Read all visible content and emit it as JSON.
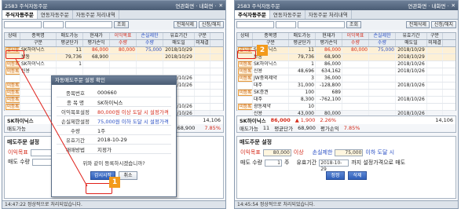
{
  "left": {
    "title": "2583 주식자동주문",
    "title_tail": "연관화면 · 내화면 ·",
    "tabs": [
      "주식자동주문",
      "연동자동주문",
      "자동주문 처리내역"
    ],
    "ctrl": {
      "account": "",
      "pw": "",
      "lookup": "조회",
      "cancel_all": "전체삭제",
      "confirm": "신청/해지"
    },
    "headers": [
      [
        "상태",
        "종목명",
        "매도가능",
        "현재가",
        "이익목표",
        "손실제한",
        "유효기간",
        "구분"
      ],
      [
        "",
        "구분",
        "평균단가",
        "평가손익",
        "수량",
        "수량",
        "매도일",
        "미체결"
      ]
    ],
    "rows": [
      {
        "state": "감시중",
        "name": "SK하이닉스",
        "q": "11",
        "price": "86,000",
        "profit": "80,000",
        "loss": "75,000",
        "exp": "2018/10/29"
      },
      {
        "state": "",
        "name": "보통",
        "q": "79,736",
        "price": "68,900",
        "profit": "",
        "loss": "",
        "exp": "2018/10/29"
      },
      {
        "state": "미등록",
        "name": "SK하이닉스",
        "q": "1",
        "price": "",
        "profit": "",
        "loss": "",
        "exp": ""
      },
      {
        "state": "미등록",
        "name": "신용",
        "q": "",
        "price": "",
        "profit": "",
        "loss": "",
        "exp": ""
      },
      {
        "state": "",
        "name": "",
        "q": "",
        "price": "",
        "profit": "",
        "loss": "",
        "exp": "2018/10/26"
      },
      {
        "state": "미등록",
        "name": "",
        "q": "",
        "price": "",
        "profit": "",
        "loss": "",
        "exp": "2018/10/26"
      },
      {
        "state": "미등록",
        "name": "",
        "q": "",
        "price": "",
        "profit": "",
        "loss": "",
        "exp": ""
      },
      {
        "state": "미등록",
        "name": "",
        "q": "",
        "price": "",
        "profit": "",
        "loss": "",
        "exp": ""
      },
      {
        "state": "미등록",
        "name": "",
        "q": "",
        "price": "",
        "profit": "",
        "loss": "",
        "exp": "2018/10/26"
      },
      {
        "state": "",
        "name": "",
        "q": "",
        "price": "",
        "profit": "",
        "loss": "",
        "exp": "2018/10/26"
      },
      {
        "state": "",
        "name": "",
        "q": "",
        "price": "",
        "profit": "",
        "loss": "",
        "exp": "2018/10/26"
      }
    ],
    "summary": {
      "name": "SK하이닉스",
      "price": "14,106",
      "avg_label": "매도가능",
      "avg": "68,900",
      "pct": "7.85%"
    },
    "setting_title": "매도주문 설정",
    "profit_label": "이익목표",
    "loss_label": "매도 수량",
    "status": "14:47:22  정상적으로 처리되었습니다.",
    "modal": {
      "title": "자동매도주문 설정 확인",
      "rows": [
        {
          "k": "종목번호",
          "v": "000660"
        },
        {
          "k": "종 목 명",
          "v": "SK하이닉스"
        },
        {
          "k": "이익목표설정",
          "v": "80,000원 이상 도달 시 설정가격"
        },
        {
          "k": "손실제한설정",
          "v": "75,000원 이하 도달 시 설정가격"
        },
        {
          "k": "수량",
          "v": "1주"
        },
        {
          "k": "유효기간",
          "v": "2018-10-29"
        },
        {
          "k": "매매방법",
          "v": "지정가"
        }
      ],
      "question": "위와 같이 등록하시겠습니까?",
      "ok": "감시시작",
      "cancel": "취소"
    },
    "callout": "1"
  },
  "right": {
    "title": "2583 주식자동주문",
    "title_tail": "연관화면 · 내화면 ·",
    "tabs": [
      "주식자동주문",
      "연동자동주문",
      "자동주문 처리내역"
    ],
    "ctrl": {
      "lookup": "조회",
      "cancel_all": "전체삭제",
      "confirm": "신청/해지"
    },
    "headers": [
      [
        "상태",
        "종목명",
        "매도가능",
        "현재가",
        "이익목표",
        "손실제한",
        "유효기간",
        "구분"
      ],
      [
        "",
        "구분",
        "평균단가",
        "평가손익",
        "수량",
        "수량",
        "매도일",
        "미체결"
      ]
    ],
    "rows": [
      {
        "state": "감시중",
        "name": "SK하이닉스",
        "q": "11",
        "price": "86,000",
        "profit": "80,000",
        "loss": "75,000",
        "exp": "2018/10/29"
      },
      {
        "state": "",
        "name": "보통",
        "q": "79,736",
        "price": "68,900",
        "profit": "",
        "loss": "",
        "exp": "2018/10/29"
      },
      {
        "state": "미등록",
        "name": "SK하이닉스",
        "q": "1",
        "price": "86,000",
        "profit": "",
        "loss": "",
        "exp": "2018/10/26"
      },
      {
        "state": "미등록",
        "name": "신용",
        "q": "48,696",
        "price": "634,162",
        "profit": "",
        "loss": "",
        "exp": "2018/10/26"
      },
      {
        "state": "미등록",
        "name": "JW중외제약",
        "q": "3",
        "price": "36,000",
        "profit": "",
        "loss": "",
        "exp": ""
      },
      {
        "state": "",
        "name": "대주",
        "q": "31,000",
        "price": "-128,800",
        "profit": "",
        "loss": "",
        "exp": "2018/10/26"
      },
      {
        "state": "미등록",
        "name": "SK증권",
        "q": "100",
        "price": "689",
        "profit": "",
        "loss": "",
        "exp": ""
      },
      {
        "state": "",
        "name": "대주",
        "q": "8,300",
        "price": "-762,100",
        "profit": "",
        "loss": "",
        "exp": "2018/10/26"
      },
      {
        "state": "미등록",
        "name": "광동제약",
        "q": "10",
        "price": "",
        "profit": "",
        "loss": "",
        "exp": ""
      },
      {
        "state": "",
        "name": "신용",
        "q": "43,000",
        "price": "80,000",
        "profit": "",
        "loss": "",
        "exp": "2018/10/26"
      }
    ],
    "summary": {
      "name": "SK하이닉스",
      "price": "86,000",
      "change": "▲ 1,900",
      "chg_pct": "2.26%",
      "vol": "14,106",
      "avg_label": "매도가능",
      "q": "11",
      "avg_k": "평균단가",
      "avg": "68,900",
      "pl_k": "평가손익",
      "pct": "7.85%"
    },
    "setting_title": "매도주문 설정",
    "profit_label": "이익목표",
    "profit_val": "80,000",
    "profit_cond": "이상",
    "loss_label": "손실제한",
    "loss_val": "75,000",
    "loss_cond": "이하 도달 시",
    "qty_label": "매도 수량",
    "qty_val": "1",
    "qty_unit": "주",
    "exp_label": "유효기간",
    "exp_val": "2018-10-29",
    "exp_tail": "까지 설정가격으로 매도",
    "save": "정정",
    "del": "삭제",
    "status": "14:45:54  정상적으로 처리되었습니다.",
    "callout": "2"
  }
}
